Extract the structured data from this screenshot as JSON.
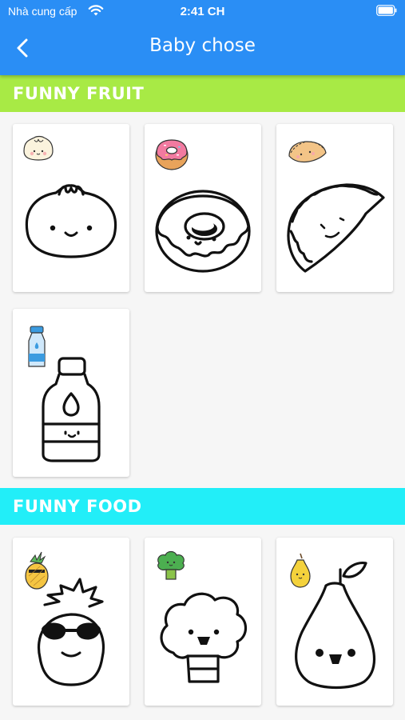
{
  "status_bar": {
    "carrier": "Nhà cung cấp",
    "time": "2:41 CH"
  },
  "header": {
    "title": "Baby chose",
    "back_icon": "chevron-left-icon",
    "background": "#2a8ef5"
  },
  "sections": [
    {
      "title": "FUNNY FRUIT",
      "color": "#a8ea45",
      "items": [
        "bao-bun",
        "donut",
        "dumpling",
        "water-bottle"
      ]
    },
    {
      "title": "FUNNY FOOD",
      "color": "#22eef8",
      "items": [
        "pineapple",
        "broccoli",
        "pear"
      ]
    }
  ]
}
